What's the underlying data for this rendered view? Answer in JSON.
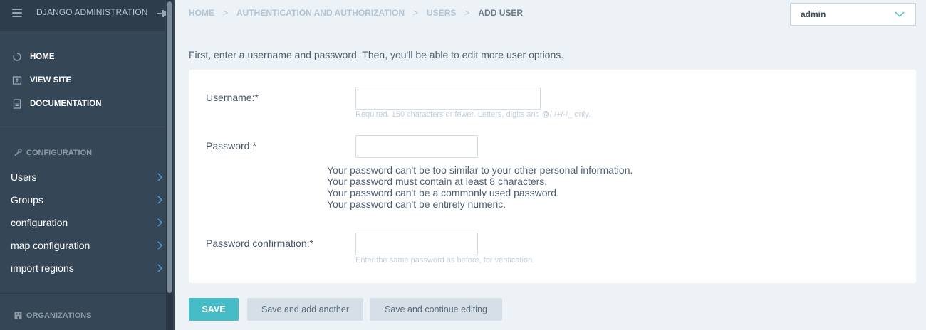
{
  "sidebar": {
    "app_title": "DJANGO ADMINISTRATION",
    "quick_links": [
      {
        "label": "HOME",
        "icon": "home-icon"
      },
      {
        "label": "VIEW SITE",
        "icon": "view-site-icon"
      },
      {
        "label": "DOCUMENTATION",
        "icon": "documentation-icon"
      }
    ],
    "sections": [
      {
        "title": "CONFIGURATION",
        "icon": "wrench-icon"
      },
      {
        "title": "ORGANIZATIONS",
        "icon": "building-icon"
      }
    ],
    "config_items": [
      {
        "label": "Users"
      },
      {
        "label": "Groups"
      },
      {
        "label": "configuration"
      },
      {
        "label": "map configuration"
      },
      {
        "label": "import regions"
      }
    ]
  },
  "breadcrumb": {
    "items": [
      "HOME",
      "AUTHENTICATION AND AUTHORIZATION",
      "USERS"
    ],
    "current": "ADD USER",
    "separator": ">"
  },
  "user_menu": {
    "value": "admin"
  },
  "intro_text": "First, enter a username and password. Then, you'll be able to edit more user options.",
  "form": {
    "username": {
      "label": "Username:*",
      "value": "",
      "help": "Required. 150 characters or fewer. Letters, digits and @/./+/-/_ only."
    },
    "password": {
      "label": "Password:*",
      "value": "",
      "rules": [
        "Your password can't be too similar to your other personal information.",
        "Your password must contain at least 8 characters.",
        "Your password can't be a commonly used password.",
        "Your password can't be entirely numeric."
      ]
    },
    "password_confirmation": {
      "label": "Password confirmation:*",
      "value": "",
      "help": "Enter the same password as before, for verification."
    }
  },
  "actions": {
    "save": "SAVE",
    "save_add_another": "Save and add another",
    "save_continue": "Save and continue editing"
  },
  "colors": {
    "sidebar_bg": "#354656",
    "page_bg": "#ecf2f6",
    "accent": "#46bdc6",
    "secondary_button": "#d6dfe7"
  }
}
